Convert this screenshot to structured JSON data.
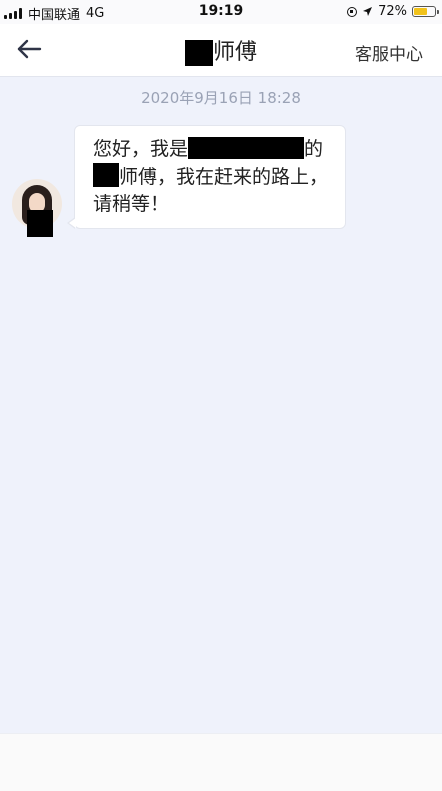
{
  "status_bar": {
    "carrier": "中国联通",
    "network": "4G",
    "time": "19:19",
    "battery_text": "72%",
    "battery_level": 0.72,
    "battery_color": "#f1c21b"
  },
  "header": {
    "back_icon": "arrow-left-icon",
    "title_suffix": "师傅",
    "service_label": "客服中心"
  },
  "chat": {
    "timestamp": "2020年9月16日 18:28",
    "message": {
      "part1": "您好，我是",
      "part2": "的",
      "part3": "师傅，我在赶来的路上，请稍等！"
    }
  },
  "colors": {
    "background": "#eff2fb",
    "timestamp": "#9aa2b5",
    "redaction": "#000000"
  }
}
